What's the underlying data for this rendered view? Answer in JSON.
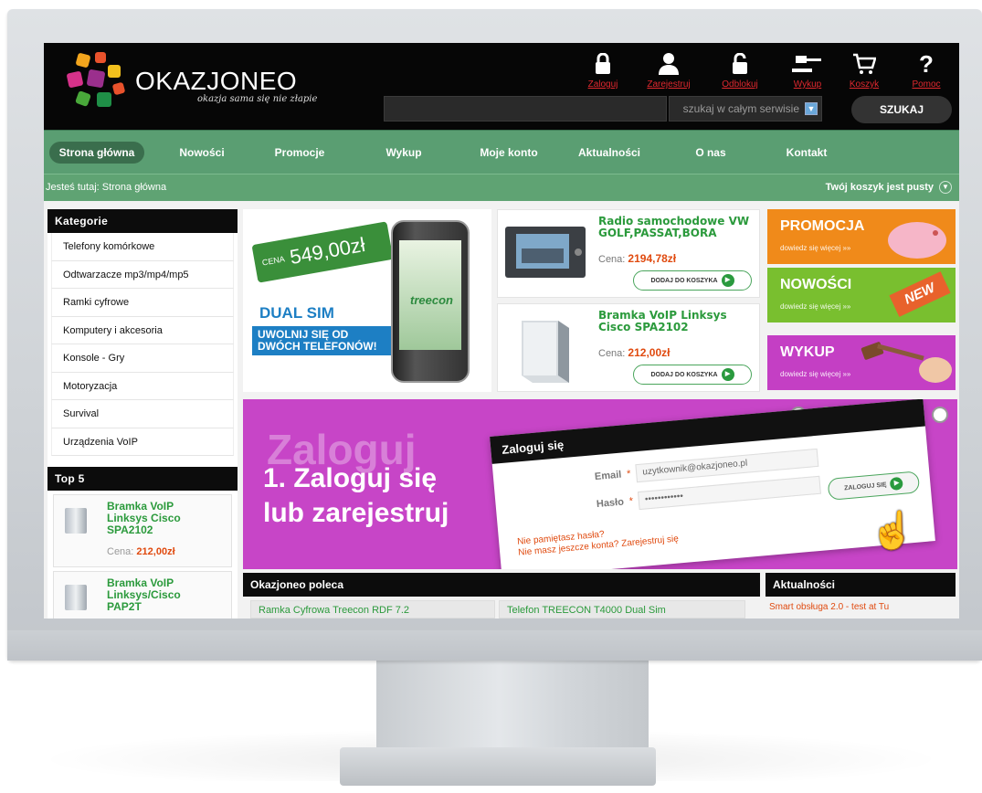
{
  "brand": {
    "name": "OKAZJONEO",
    "tagline": "okazja sama się nie złapie"
  },
  "header_links": [
    {
      "label": "Zaloguj",
      "icon": "lock-icon"
    },
    {
      "label": "Zarejestruj",
      "icon": "user-icon"
    },
    {
      "label": "Odblokuj",
      "icon": "unlock-icon"
    },
    {
      "label": "Wykup",
      "icon": "gavel-icon"
    },
    {
      "label": "Koszyk",
      "icon": "cart-icon"
    },
    {
      "label": "Pomoc",
      "icon": "help-icon"
    }
  ],
  "search": {
    "value": "",
    "scope": "szukaj w całym serwisie",
    "button": "SZUKAJ"
  },
  "nav": [
    "Strona główna",
    "Nowości",
    "Promocje",
    "Wykup",
    "Moje konto",
    "Aktualności",
    "O nas",
    "Kontakt"
  ],
  "breadcrumb": "Jesteś tutaj: Strona główna",
  "cart_status": "Twój koszyk jest pusty",
  "categories": {
    "title": "Kategorie",
    "items": [
      "Telefony komórkowe",
      "Odtwarzacze mp3/mp4/mp5",
      "Ramki cyfrowe",
      "Komputery i akcesoria",
      "Konsole - Gry",
      "Motoryzacja",
      "Survival",
      "Urządzenia VoIP"
    ]
  },
  "top5": {
    "title": "Top 5",
    "items": [
      {
        "name": "Bramka VoIP Linksys Cisco SPA2102",
        "price_label": "Cena:",
        "price": "212,00zł"
      },
      {
        "name": "Bramka VoIP Linksys/Cisco PAP2T",
        "price_label": "",
        "price": ""
      }
    ]
  },
  "phone_promo": {
    "cena": "CENA",
    "price": "549,00zł",
    "dual": "DUAL SIM",
    "slogan": "UWOLNIJ SIĘ OD DWÓCH TELEFONÓW!",
    "brand": "treecon"
  },
  "products": [
    {
      "name": "Radio samochodowe VW GOLF,PASSAT,BORA",
      "price_label": "Cena:",
      "price": "2194,78zł",
      "button": "DODAJ DO KOSZYKA"
    },
    {
      "name": "Bramka VoIP Linksys Cisco SPA2102",
      "price_label": "Cena:",
      "price": "212,00zł",
      "button": "DODAJ DO KOSZYKA"
    }
  ],
  "side_promos": [
    {
      "title": "PROMOCJA",
      "sub": "dowiedz się więcej »»",
      "color": "#f08a1a"
    },
    {
      "title": "NOWOŚCI",
      "sub": "dowiedz się więcej »»",
      "color": "#79bf2f"
    },
    {
      "title": "WYKUP",
      "sub": "dowiedz się więcej »»",
      "color": "#c43fc4"
    }
  ],
  "slider": {
    "ghost": "Zaloguj",
    "headline_1": "1. Zaloguj się",
    "headline_2": "lub zarejestruj",
    "login_title": "Zaloguj się",
    "email_label": "Email",
    "email_value": "uzytkownik@okazjoneo.pl",
    "password_label": "Hasło",
    "password_value": "••••••••••••",
    "forgot": "Nie pamiętasz hasła?",
    "noaccount": "Nie masz jeszcze konta? Zarejestruj się",
    "login_button": "ZALOGUJ SIĘ",
    "active_slide": 2,
    "slide_count": 6
  },
  "poleca": {
    "title": "Okazjoneo poleca",
    "items": [
      "Ramka Cyfrowa Treecon RDF 7.2",
      "Telefon TREECON T4000 Dual Sim"
    ]
  },
  "news": {
    "title": "Aktualności",
    "items": [
      "Smart obsługa 2.0 - test at Tu"
    ]
  }
}
